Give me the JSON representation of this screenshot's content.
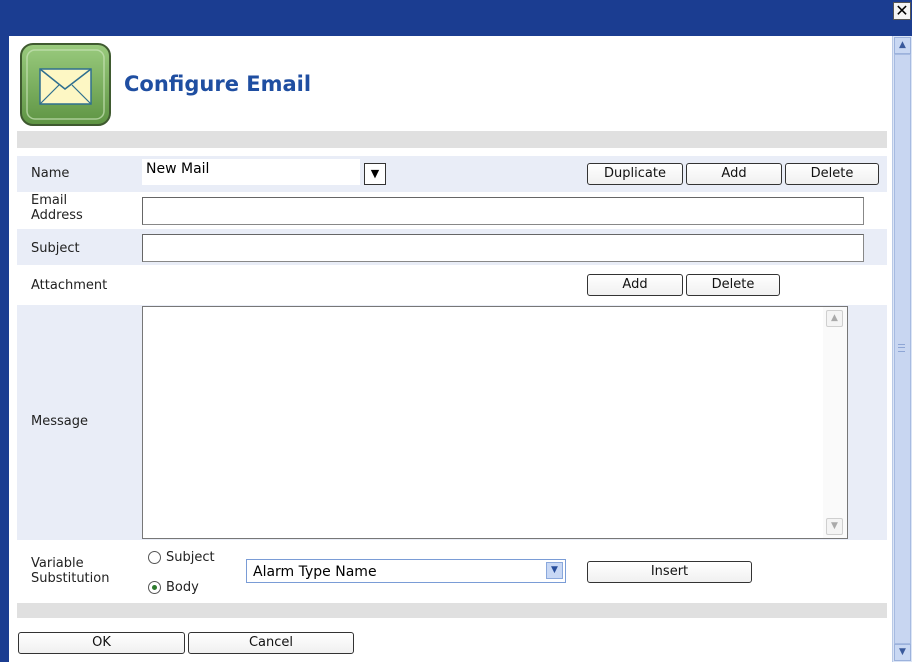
{
  "window": {
    "close_glyph": "✕"
  },
  "header": {
    "icon": "envelope-icon",
    "title": "Configure Email"
  },
  "form": {
    "name": {
      "label": "Name",
      "value": "New Mail",
      "dropdown_glyph": "▼"
    },
    "name_buttons": {
      "duplicate": "Duplicate",
      "add": "Add",
      "delete": "Delete"
    },
    "email": {
      "label_line1": "Email",
      "label_line2": "Address",
      "value": ""
    },
    "subject": {
      "label": "Subject",
      "value": ""
    },
    "attachment": {
      "label": "Attachment",
      "add": "Add",
      "delete": "Delete"
    },
    "message": {
      "label": "Message",
      "value": ""
    },
    "variable_substitution": {
      "label_line1": "Variable",
      "label_line2": "Substitution",
      "options": [
        "Subject",
        "Body"
      ],
      "selected": "Body",
      "select_value": "Alarm Type Name",
      "insert": "Insert"
    }
  },
  "footer": {
    "ok": "OK",
    "cancel": "Cancel"
  },
  "colors": {
    "titlebar": "#1b3d91",
    "title_text": "#1f4ea1",
    "row_bg": "#e9edf7"
  }
}
